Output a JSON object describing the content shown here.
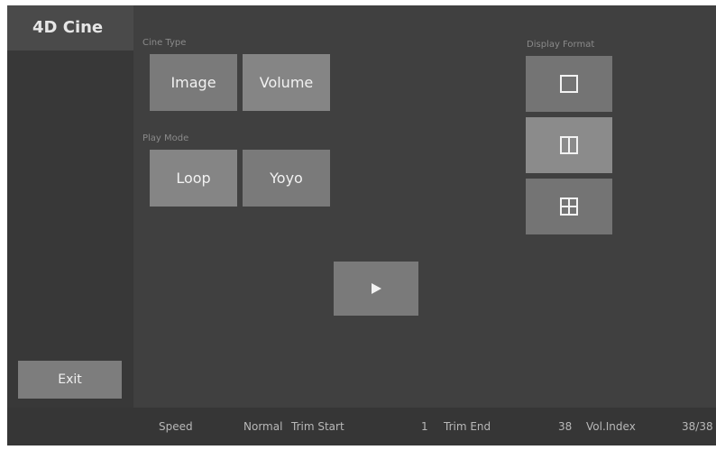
{
  "app": {
    "title": "4D Cine"
  },
  "sidebar": {
    "exit_label": "Exit"
  },
  "cine_type": {
    "label": "Cine Type",
    "options": [
      "Image",
      "Volume"
    ],
    "selected": "Volume"
  },
  "play_mode": {
    "label": "Play Mode",
    "options": [
      "Loop",
      "Yoyo"
    ],
    "selected": "Loop"
  },
  "display_format": {
    "label": "Display Format",
    "options": [
      "single-layout-icon",
      "dual-layout-icon",
      "quad-layout-icon"
    ],
    "selected": "dual-layout-icon"
  },
  "play": {
    "icon": "play-icon"
  },
  "status": {
    "speed_label": "Speed",
    "speed_value": "Normal",
    "trim_start_label": "Trim Start",
    "trim_start_value": "1",
    "trim_end_label": "Trim End",
    "trim_end_value": "38",
    "vol_index_label": "Vol.Index",
    "vol_index_value": "38/38"
  },
  "colors": {
    "background": "#3f3f3f",
    "button": "#7a7a7a",
    "button_selected": "#8b8b8b",
    "text": "#f2f2f2",
    "label": "#8a8a8a"
  }
}
